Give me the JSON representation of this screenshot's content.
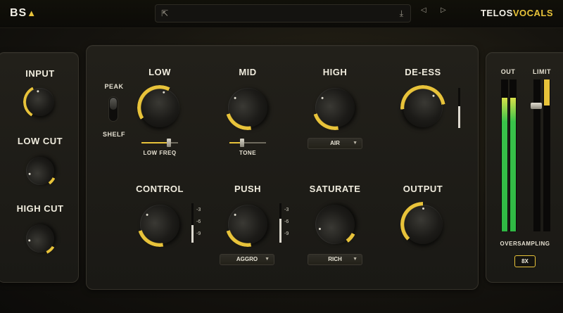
{
  "header": {
    "logo_text": "BS",
    "brand_main": "TELOS",
    "brand_accent": "VOCALS",
    "preset_icon": "external-link-icon",
    "save_icon": "download-icon"
  },
  "left_panel": {
    "knobs": [
      {
        "label": "INPUT",
        "value_fraction": 0.45
      },
      {
        "label": "LOW CUT",
        "value_fraction": 0.1
      },
      {
        "label": "HIGH CUT",
        "value_fraction": 0.12
      }
    ]
  },
  "main_panel": {
    "low": {
      "label": "LOW",
      "value_fraction": 0.55,
      "slider_label": "LOW FREQ",
      "slider_value": 0.75
    },
    "peak_shelf": {
      "top_label": "PEAK",
      "bottom_label": "SHELF",
      "selected": "PEAK"
    },
    "mid": {
      "label": "MID",
      "value_fraction": 0.3,
      "slider_label": "TONE",
      "slider_value": 0.35
    },
    "high": {
      "label": "HIGH",
      "value_fraction": 0.3,
      "dropdown_value": "AIR"
    },
    "deess": {
      "label": "DE-ESS",
      "value_fraction": 0.65,
      "meter_level": 0.55
    },
    "control": {
      "label": "CONTROL",
      "value_fraction": 0.3,
      "meter_level": 0.45,
      "scale": [
        "-3",
        "-6",
        "-9"
      ]
    },
    "push": {
      "label": "PUSH",
      "value_fraction": 0.3,
      "meter_level": 0.6,
      "scale": [
        "-3",
        "-6",
        "-9"
      ],
      "dropdown_value": "AGGRO"
    },
    "saturate": {
      "label": "SATURATE",
      "value_fraction": 0.1,
      "dropdown_value": "RICH"
    },
    "output": {
      "label": "OUTPUT",
      "value_fraction": 0.5
    }
  },
  "right_panel": {
    "out_label": "OUT",
    "limit_label": "LIMIT",
    "out_levels": [
      0.88,
      0.88
    ],
    "limit_level": 0.17,
    "oversampling_label": "OVERSAMPLING",
    "oversampling_value": "8X"
  },
  "colors": {
    "accent": "#e8c33a",
    "meter_green": "#2fb844"
  }
}
